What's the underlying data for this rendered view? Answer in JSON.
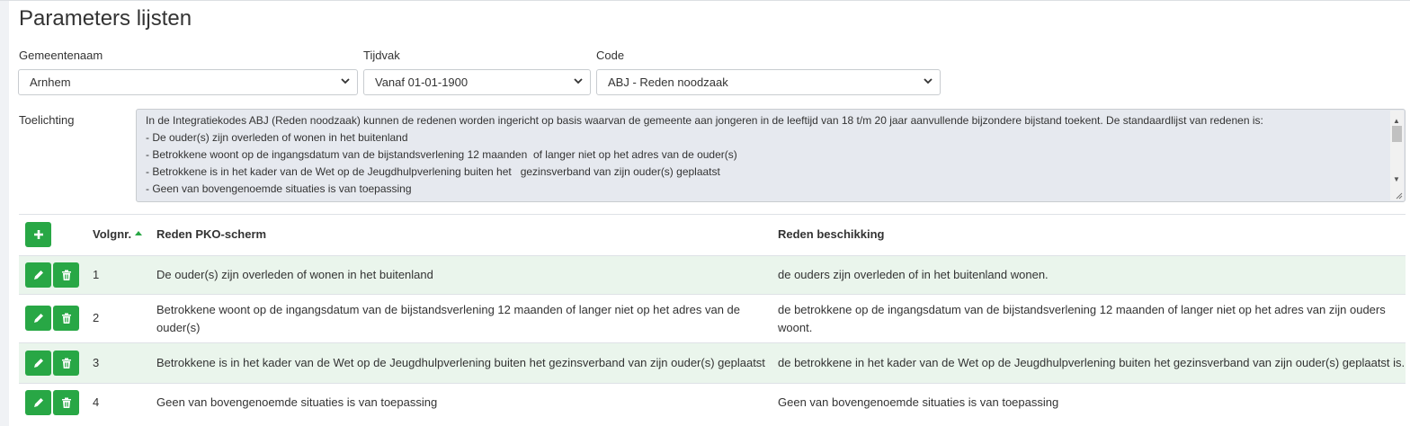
{
  "page": {
    "title": "Parameters lijsten"
  },
  "filters": {
    "gemeente": {
      "label": "Gemeentenaam",
      "value": "Arnhem"
    },
    "tijdvak": {
      "label": "Tijdvak",
      "value": "Vanaf 01-01-1900"
    },
    "code": {
      "label": "Code",
      "value": "ABJ - Reden noodzaak"
    }
  },
  "toelichting": {
    "label": "Toelichting",
    "lines": [
      "In de Integratiekodes ABJ (Reden noodzaak) kunnen de redenen worden ingericht op basis waarvan de gemeente aan jongeren in de leeftijd van 18 t/m 20 jaar aanvullende bijzondere bijstand toekent. De standaardlijst van redenen is:",
      "- De ouder(s) zijn overleden of wonen in het buitenland",
      "- Betrokkene woont op de ingangsdatum van de bijstandsverlening 12 maanden  of langer niet op het adres van de ouder(s)",
      "- Betrokkene is in het kader van de Wet op de Jeugdhulpverlening buiten het   gezinsverband van zijn ouder(s) geplaatst",
      "- Geen van bovengenoemde situaties is van toepassing"
    ]
  },
  "table": {
    "columns": {
      "volgnr": "Volgnr.",
      "reden_pko": "Reden PKO-scherm",
      "reden_beschikking": "Reden beschikking"
    },
    "rows": [
      {
        "volgnr": "1",
        "reden_pko": [
          "De ouder(s) zijn overleden of wonen in het buitenland"
        ],
        "reden_beschikking": [
          "de ouders zijn overleden of in het buitenland wonen."
        ]
      },
      {
        "volgnr": "2",
        "reden_pko": [
          "Betrokkene woont op de ingangsdatum van de bijstandsverlening 12 maanden of langer niet op het adres van de",
          "ouder(s)"
        ],
        "reden_beschikking": [
          "de betrokkene op de ingangsdatum van de bijstandsverlening 12 maanden of langer niet op het adres van zijn ouders",
          "woont."
        ]
      },
      {
        "volgnr": "3",
        "reden_pko": [
          "Betrokkene is in het kader van de Wet op de Jeugdhulpverlening buiten het gezinsverband van zijn ouder(s) geplaatst"
        ],
        "reden_beschikking": [
          "de betrokkene in het kader van de Wet op de Jeugdhulpverlening buiten het gezinsverband van zijn ouder(s) geplaatst is."
        ]
      },
      {
        "volgnr": "4",
        "reden_pko": [
          "Geen van bovengenoemde situaties is van toepassing"
        ],
        "reden_beschikking": [
          "Geen van bovengenoemde situaties is van toepassing"
        ]
      }
    ]
  },
  "icons": {
    "add": "plus-icon",
    "edit": "pencil-icon",
    "delete": "trash-icon",
    "sort": "sort-asc-icon",
    "dropdown": "chevron-down-icon"
  },
  "colors": {
    "accent": "#28a745",
    "row_highlight": "#eaf5ec",
    "textarea_bg": "#e6e9ef"
  }
}
